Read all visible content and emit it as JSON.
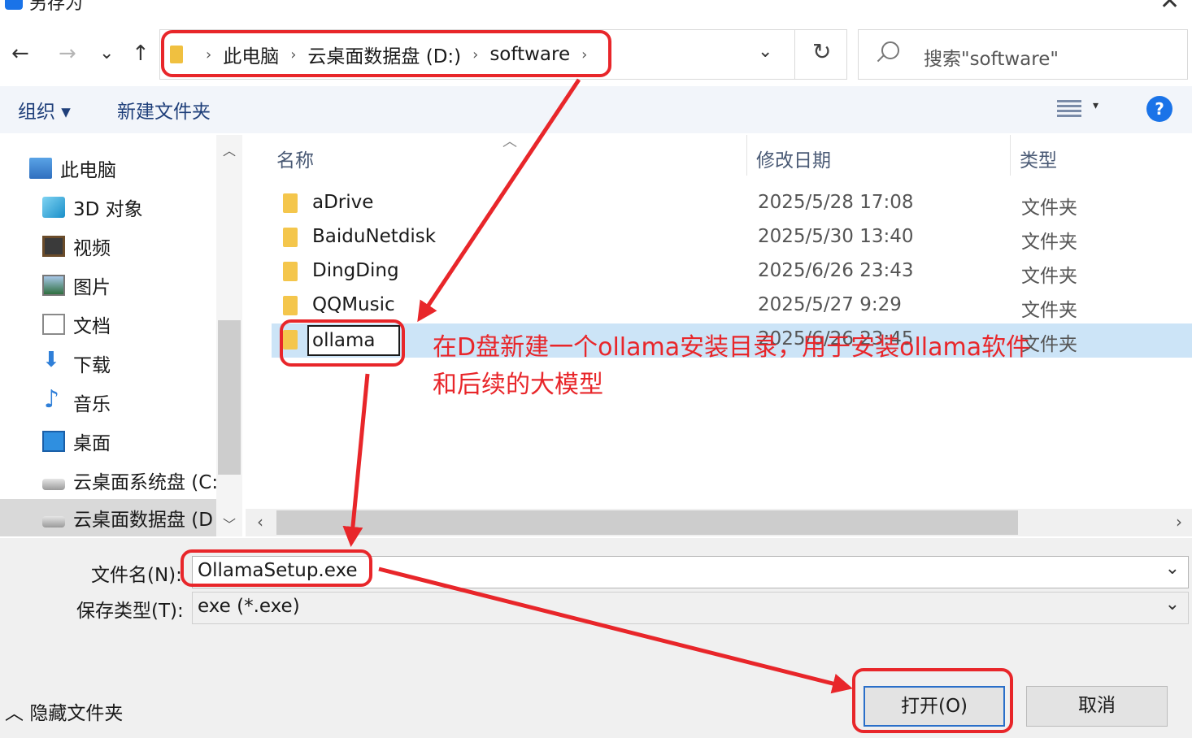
{
  "window": {
    "title": "另存为",
    "close_glyph": "✕"
  },
  "nav_buttons": {
    "back": "←",
    "forward": "→",
    "recent": "⌄",
    "up": "↑"
  },
  "breadcrumb": [
    "此电脑",
    "云桌面数据盘 (D:)",
    "software"
  ],
  "address": {
    "dropdown": "⌄",
    "refresh": "↻"
  },
  "search": {
    "placeholder": "搜索\"software\""
  },
  "toolbar": {
    "organize": "组织 ▾",
    "new_folder": "新建文件夹",
    "view_dropdown": "▾",
    "help": "?"
  },
  "sidebar": {
    "items": [
      {
        "label": "此电脑",
        "icon": "pc-icon"
      },
      {
        "label": "3D 对象",
        "icon": "3d-objects-icon"
      },
      {
        "label": "视频",
        "icon": "video-icon"
      },
      {
        "label": "图片",
        "icon": "picture-icon"
      },
      {
        "label": "文档",
        "icon": "document-icon"
      },
      {
        "label": "下载",
        "icon": "download-icon"
      },
      {
        "label": "音乐",
        "icon": "music-icon"
      },
      {
        "label": "桌面",
        "icon": "desktop-icon"
      },
      {
        "label": "云桌面系统盘 (C:",
        "icon": "drive-icon"
      },
      {
        "label": "云桌面数据盘 (D",
        "icon": "drive-icon"
      }
    ]
  },
  "columns": {
    "name": "名称",
    "modified": "修改日期",
    "type": "类型"
  },
  "files": [
    {
      "name": "aDrive",
      "modified": "2025/5/28 17:08",
      "type": "文件夹"
    },
    {
      "name": "BaiduNetdisk",
      "modified": "2025/5/30 13:40",
      "type": "文件夹"
    },
    {
      "name": "DingDing",
      "modified": "2025/6/26 23:43",
      "type": "文件夹"
    },
    {
      "name": "QQMusic",
      "modified": "2025/5/27 9:29",
      "type": "文件夹"
    },
    {
      "name": "ollama",
      "modified": "2025/6/26 23:45",
      "type": "文件夹"
    }
  ],
  "annotation": {
    "line1": "在D盘新建一个ollama安装目录，用于安装ollama软件",
    "line2": "和后续的大模型"
  },
  "filename": {
    "label": "文件名(N):",
    "value": "OllamaSetup.exe"
  },
  "filetype": {
    "label": "保存类型(T):",
    "value": "exe (*.exe)"
  },
  "footer": {
    "hide_folders": "隐藏文件夹",
    "open": "打开(O)",
    "cancel": "取消"
  },
  "colors": {
    "annotation_red": "#e8262a",
    "selected_row": "#cce4f7",
    "accent_blue": "#1a73e8"
  }
}
